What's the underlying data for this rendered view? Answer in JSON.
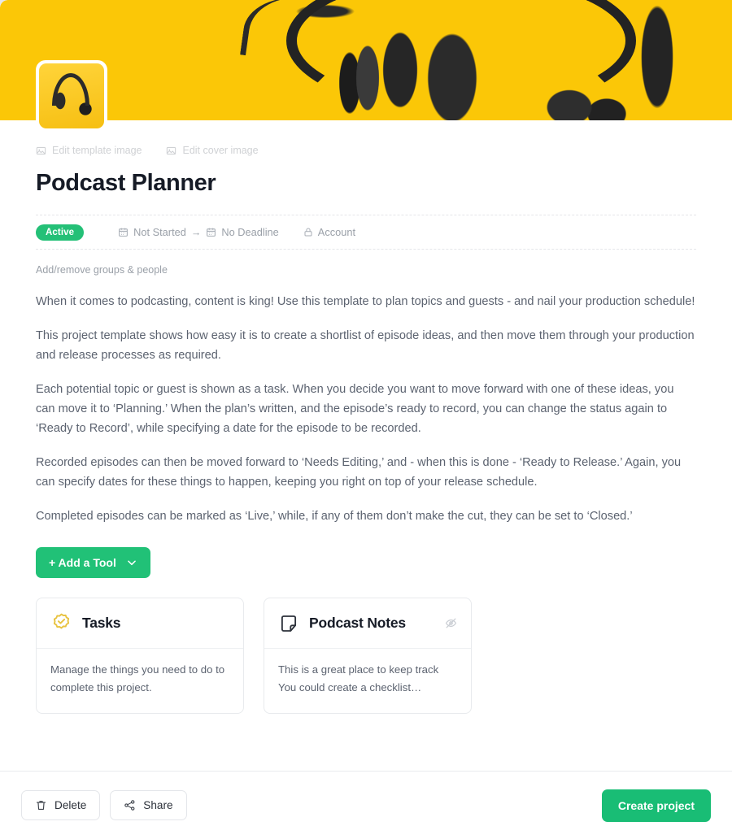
{
  "cover": {
    "alt": "headphones on yellow background",
    "background_color": "#FBC707"
  },
  "avatar": {
    "alt": "headphones template thumbnail"
  },
  "edit_links": [
    {
      "icon": "image-icon",
      "label": "Edit template image"
    },
    {
      "icon": "image-icon",
      "label": "Edit cover image"
    }
  ],
  "header": {
    "title": "Podcast Planner"
  },
  "meta": {
    "status_label": "Active",
    "status_color": "#24c077",
    "start": {
      "icon": "calendar-icon",
      "label": "Not Started"
    },
    "arrow": "→",
    "deadline": {
      "icon": "calendar-icon",
      "label": "No Deadline"
    },
    "privacy": {
      "icon": "lock-icon",
      "label": "Account"
    }
  },
  "groups_link": "Add/remove groups & people",
  "description": [
    "When it comes to podcasting, content is king! Use this template to plan topics and guests - and nail your production schedule!",
    "This project template shows how easy it is to create a shortlist of episode ideas, and then move them through your production and release processes as required.",
    "Each potential topic or guest is shown as a task. When you decide you want to move forward with one of these ideas, you can move it to ‘Planning.’ When the plan’s written, and the episode’s ready to record, you can change the status again to ‘Ready to Record’, while specifying a date for the episode to be recorded.",
    "Recorded episodes can then be moved forward to ‘Needs Editing,’ and - when this is done - ‘Ready to Release.’ Again, you can specify dates for these things to happen, keeping you right on top of your release schedule.",
    "Completed episodes can be marked as ‘Live,’ while, if any of them don’t make the cut, they can be set to ‘Closed.’"
  ],
  "add_tool": {
    "label": "+ Add a Tool",
    "chevron": "chevron-down-icon",
    "color": "#21c177"
  },
  "tools": [
    {
      "icon": "check-badge-icon",
      "icon_color": "#E8C341",
      "title": "Tasks",
      "body": "Manage the things you need to do to complete this project.",
      "hidden": false
    },
    {
      "icon": "note-icon",
      "icon_color": "#2c313a",
      "title": "Podcast Notes",
      "body": "This is a great place to keep track You could create a checklist…",
      "hidden": true,
      "hidden_icon": "eye-off-icon"
    }
  ],
  "footer": {
    "delete": {
      "icon": "trash-icon",
      "label": "Delete"
    },
    "share": {
      "icon": "share-icon",
      "label": "Share"
    },
    "create": {
      "label": "Create project",
      "color": "#19bd75"
    }
  }
}
